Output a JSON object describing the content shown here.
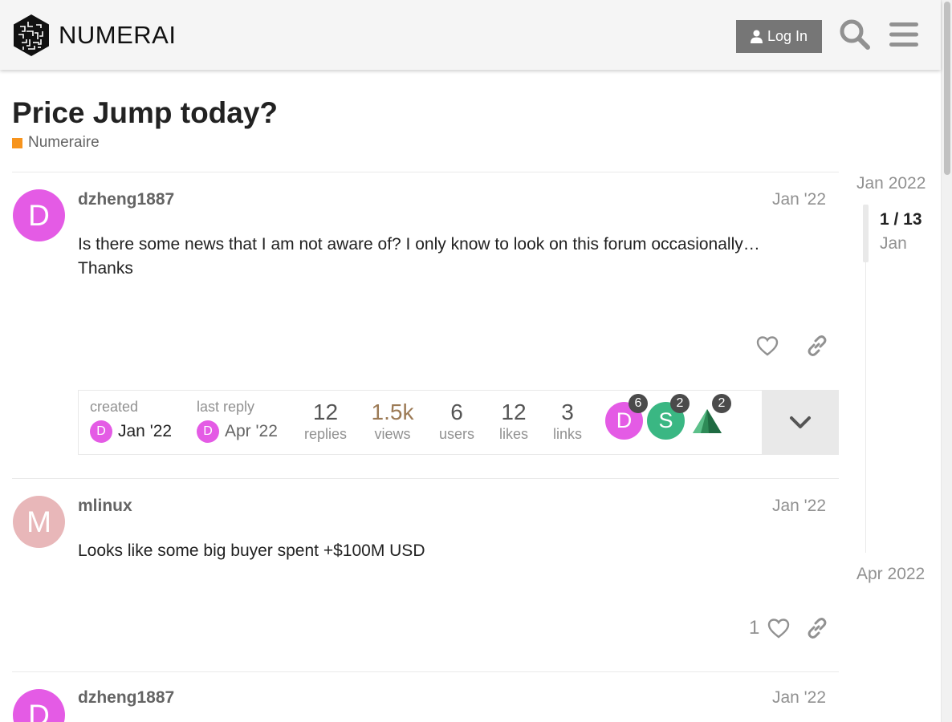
{
  "header": {
    "brand": "NUMERAI",
    "login_label": "Log In"
  },
  "topic": {
    "title": "Price Jump today?",
    "category": "Numeraire",
    "category_color": "#F7941D"
  },
  "posts": [
    {
      "username": "dzheng1887",
      "avatar_letter": "D",
      "avatar_color": "#E45BE5",
      "date": "Jan '22",
      "body": "Is there some news that I am not aware of? I only know to look on this forum occasionally… Thanks"
    },
    {
      "username": "mlinux",
      "avatar_letter": "M",
      "avatar_color": "#E8B7B9",
      "date": "Jan '22",
      "body": "Looks like some big buyer spent +$100M USD",
      "likes": "1"
    },
    {
      "username": "dzheng1887",
      "avatar_letter": "D",
      "avatar_color": "#E45BE5",
      "date": "Jan '22"
    }
  ],
  "topic_map": {
    "created_label": "created",
    "created_date": "Jan '22",
    "last_reply_label": "last reply",
    "last_reply_date": "Apr '22",
    "replies": "12",
    "replies_label": "replies",
    "views": "1.5k",
    "views_label": "views",
    "users": "6",
    "users_label": "users",
    "likes": "12",
    "likes_label": "likes",
    "links": "3",
    "links_label": "links",
    "participants": [
      {
        "letter": "D",
        "color": "#E45BE5",
        "count": "6"
      },
      {
        "letter": "S",
        "color": "#3AB783",
        "count": "2"
      },
      {
        "letter": "",
        "color": "#2E8B57",
        "count": "2"
      }
    ]
  },
  "timeline": {
    "start": "Jan 2022",
    "position": "1 / 13",
    "position_date": "Jan",
    "end": "Apr 2022"
  }
}
